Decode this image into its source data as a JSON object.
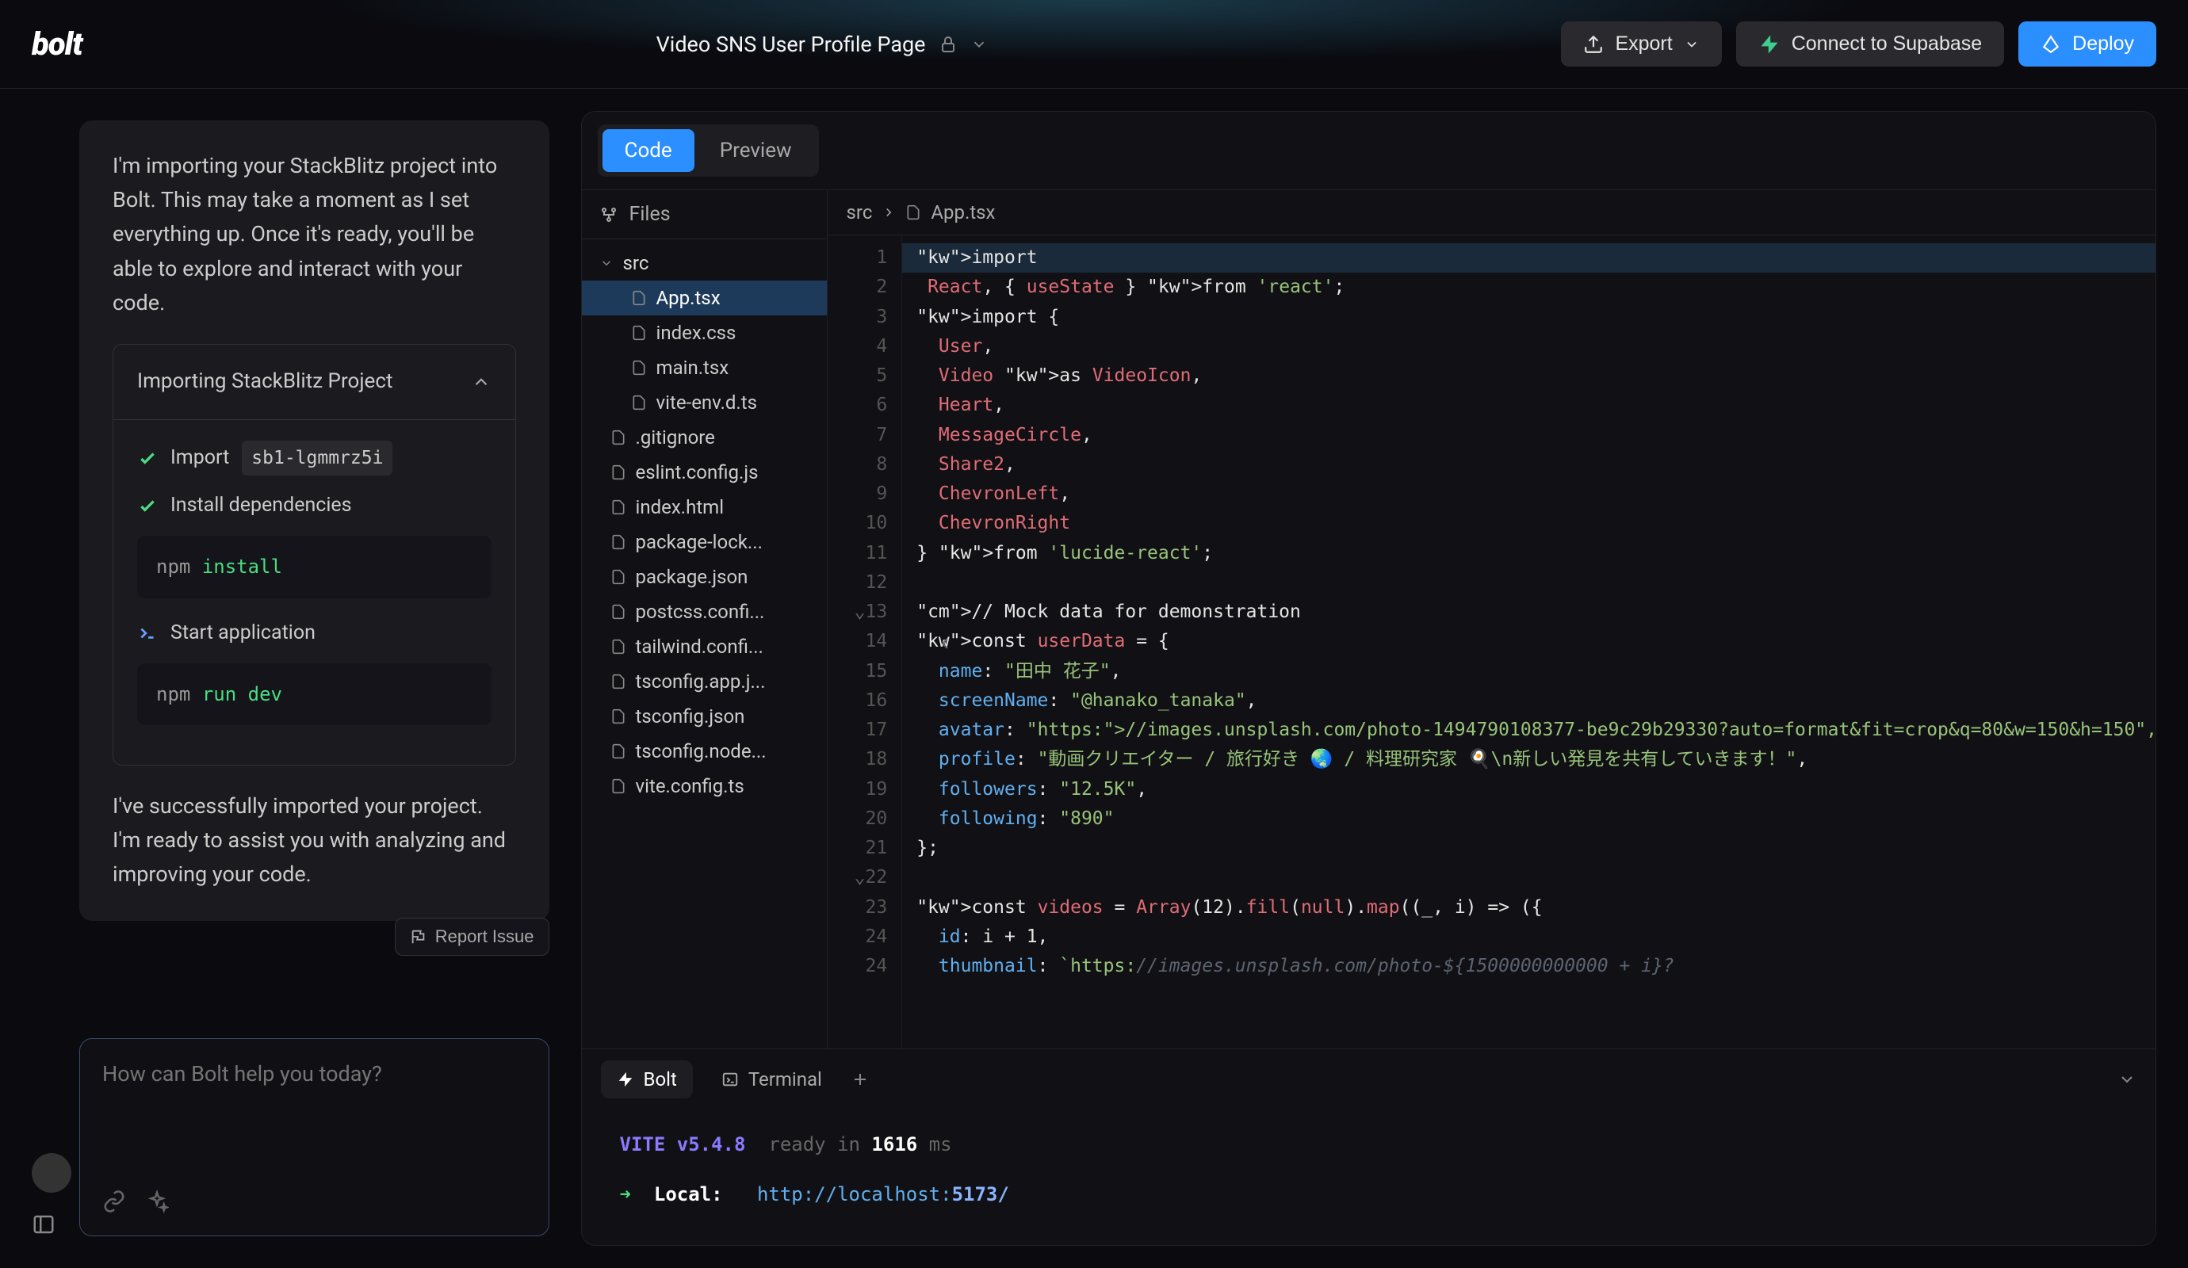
{
  "header": {
    "logo": "bolt",
    "title": "Video SNS User Profile Page",
    "export": "Export",
    "supabase": "Connect to Supabase",
    "deploy": "Deploy"
  },
  "chat": {
    "intro": "I'm importing your StackBlitz project into Bolt. This may take a moment as I set everything up. Once it's ready, you'll be able to explore and interact with your code.",
    "card_title": "Importing StackBlitz Project",
    "step_import": "Import",
    "import_tag": "sb1-lgmmrz5i",
    "step_deps": "Install dependencies",
    "npm_install_cmd": "npm",
    "npm_install_arg": "install",
    "step_start": "Start application",
    "npm_run": "npm",
    "npm_run_arg1": "run",
    "npm_run_arg2": "dev",
    "outro": "I've successfully imported your project. I'm ready to assist you with analyzing and improving your code.",
    "report": "Report Issue"
  },
  "input": {
    "placeholder": "How can Bolt help you today?"
  },
  "ide": {
    "tab_code": "Code",
    "tab_preview": "Preview",
    "files_label": "Files",
    "tree": {
      "src": "src",
      "app": "App.tsx",
      "indexcss": "index.css",
      "maintsx": "main.tsx",
      "viteenv": "vite-env.d.ts",
      "gitignore": ".gitignore",
      "eslint": "eslint.config.js",
      "indexhtml": "index.html",
      "pkglock": "package-lock...",
      "pkg": "package.json",
      "postcss": "postcss.confi...",
      "tailwind": "tailwind.confi...",
      "tsapp": "tsconfig.app.j...",
      "ts": "tsconfig.json",
      "tsnode": "tsconfig.node...",
      "vite": "vite.config.ts"
    },
    "crumb_src": "src",
    "crumb_file": "App.tsx",
    "code_lines": [
      "import React, { useState } from 'react';",
      "import {",
      "  User,",
      "  Video as VideoIcon,",
      "  Heart,",
      "  MessageCircle,",
      "  Share2,",
      "  ChevronLeft,",
      "  ChevronRight",
      "} from 'lucide-react';",
      "",
      "// Mock data for demonstration",
      "const userData = {",
      "  name: \"田中 花子\",",
      "  screenName: \"@hanako_tanaka\",",
      "  avatar: \"https://images.unsplash.com/photo-1494790108377-be9c29b29330?auto=format&fit=crop&q=80&w=150&h=150\",",
      "  profile: \"動画クリエイター / 旅行好き 🌏 / 料理研究家 🍳\\n新しい発見を共有していきます！\",",
      "  followers: \"12.5K\",",
      "  following: \"890\"",
      "};",
      "",
      "const videos = Array(12).fill(null).map((_, i) => ({",
      "  id: i + 1,",
      "  thumbnail: `https://images.unsplash.com/photo-${1500000000000 + i}?"
    ],
    "terminal": {
      "tab_bolt": "Bolt",
      "tab_term": "Terminal",
      "vite": "VITE v5.4.8",
      "ready1": "ready in",
      "ready_ms": "1616",
      "ready2": "ms",
      "local_label": "Local:",
      "local_url_pre": "http://localhost:",
      "local_url_port": "5173/"
    }
  }
}
